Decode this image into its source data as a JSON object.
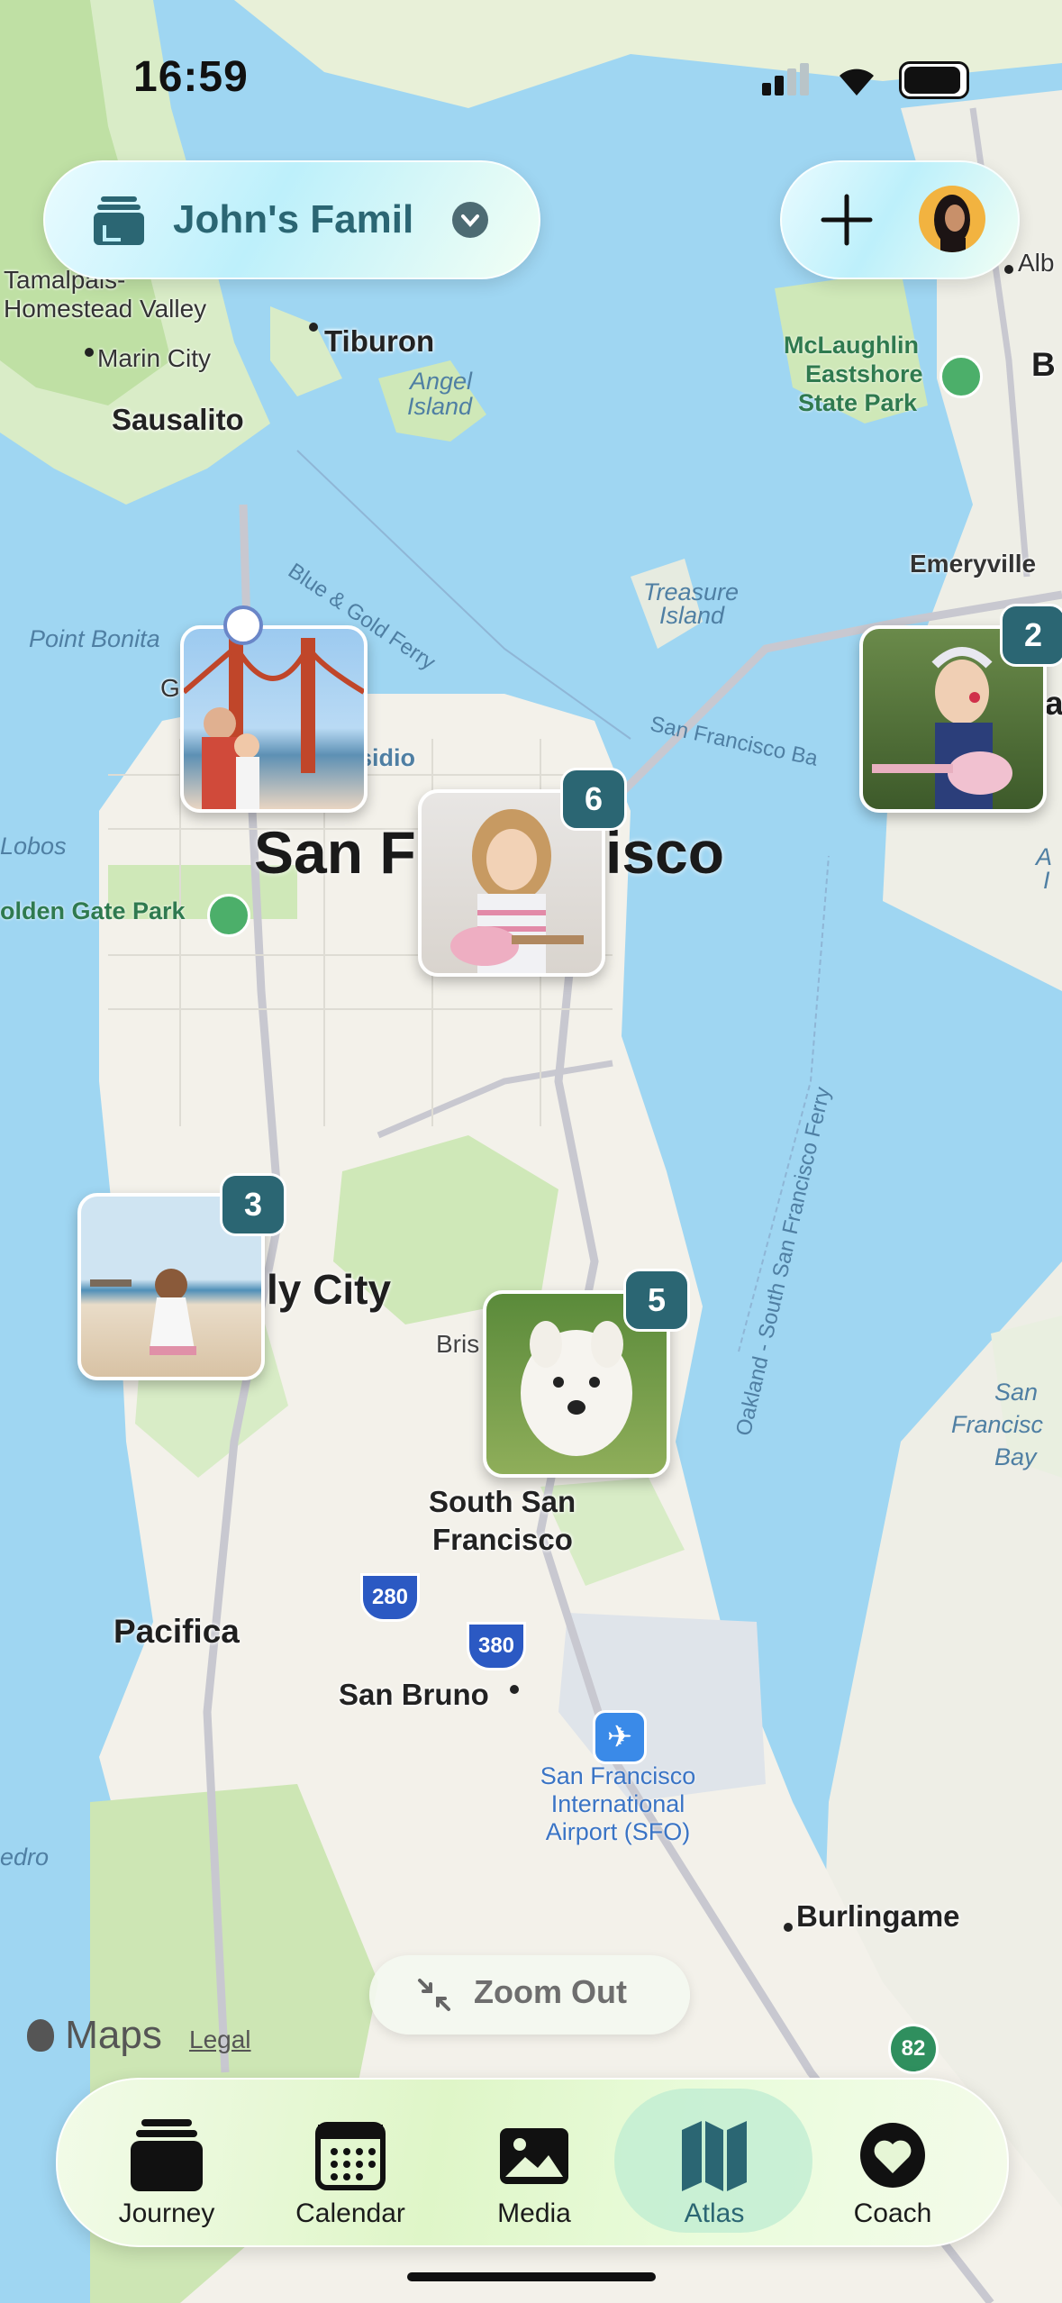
{
  "status_bar": {
    "time": "16:59"
  },
  "header": {
    "family_name": "John's Famil",
    "add_icon": "plus-icon",
    "profile_icon": "avatar"
  },
  "map_labels": {
    "tamalpais": "Tamalpais-",
    "homestead": "Homestead Valley",
    "marin_city": "Marin City",
    "tiburon": "Tiburon",
    "angel_island_1": "Angel",
    "angel_island_2": "Island",
    "sausalito": "Sausalito",
    "mclaughlin_1": "McLaughlin",
    "mclaughlin_2": "Eastshore",
    "mclaughlin_3": "State Park",
    "albany": "Alb",
    "berkeley": "B",
    "emeryville": "Emeryville",
    "treasure_1": "Treasure",
    "treasure_2": "Island",
    "blue_gold": "Blue & Gold Ferry",
    "point_bonita": "Point Bonita",
    "sf_bay_water": "San Francisco Ba",
    "presidio": "sidio",
    "san_francisco_left": "San F",
    "san_francisco_right": "isco",
    "lobos": "Lobos",
    "ggpark": "olden Gate Park",
    "oakland_fragment": "a",
    "sf_ferry": "Oakland - South San Francisco Ferry",
    "daly_city": "ly City",
    "brisbane": "Bris",
    "south_sf_1": "South San",
    "south_sf_2": "Francisco",
    "sf_bay_1": "San",
    "sf_bay_2": "Francisc",
    "sf_bay_3": "Bay",
    "pacifica": "Pacifica",
    "san_bruno": "San Bruno",
    "sfo_1": "San Francisco",
    "sfo_2": "International",
    "sfo_3": "Airport (SFO)",
    "pedro": "edro",
    "burlingame": "Burlingame",
    "hwy_280": "280",
    "hwy_380": "380",
    "hwy_82": "82",
    "g_fragment": "G",
    "alameda_fragment_1": "A",
    "alameda_fragment_2": "I"
  },
  "clusters": [
    {
      "count": "",
      "subject": "golden-gate-family"
    },
    {
      "count": "6",
      "subject": "girl-ukulele"
    },
    {
      "count": "2",
      "subject": "girl-ukulele-outdoor"
    },
    {
      "count": "3",
      "subject": "child-beach"
    },
    {
      "count": "5",
      "subject": "white-dog"
    }
  ],
  "map_controls": {
    "zoom_out": "Zoom Out",
    "maps_brand": "Maps",
    "legal": "Legal"
  },
  "tab_bar": {
    "tabs": [
      {
        "label": "Journey",
        "icon": "journey-icon"
      },
      {
        "label": "Calendar",
        "icon": "calendar-icon"
      },
      {
        "label": "Media",
        "icon": "media-icon"
      },
      {
        "label": "Atlas",
        "icon": "atlas-icon",
        "selected": true
      },
      {
        "label": "Coach",
        "icon": "coach-icon"
      }
    ]
  },
  "colors": {
    "water": "#9fd6f2",
    "land": "#f3f1ea",
    "park": "#cfe8b8",
    "badge": "#2b6673",
    "accent": "#2b6673"
  }
}
